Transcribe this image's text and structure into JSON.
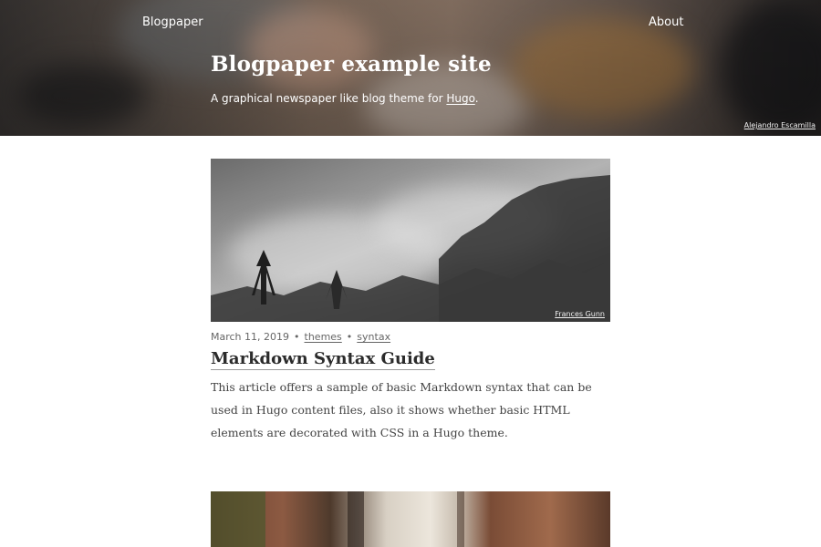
{
  "nav": {
    "brand": "Blogpaper",
    "about": "About"
  },
  "hero": {
    "title": "Blogpaper example site",
    "subtitle_text": "A graphical newspaper like blog theme for ",
    "subtitle_link": "Hugo",
    "subtitle_end": ".",
    "photo_credit": "Alejandro Escamilla"
  },
  "posts": [
    {
      "image_credit": "Frances Gunn",
      "date": "March 11, 2019",
      "separator": "•",
      "tags": [
        "themes",
        "syntax"
      ],
      "title": "Markdown Syntax Guide",
      "summary": "This article offers a sample of basic Markdown syntax that can be used in Hugo content files, also it shows whether basic HTML elements are decorated with CSS in a Hugo theme."
    }
  ]
}
